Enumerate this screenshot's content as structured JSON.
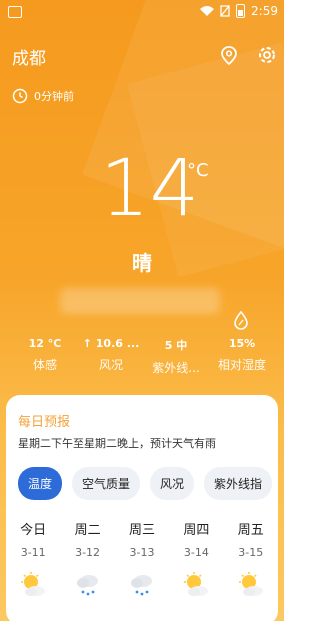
{
  "status": {
    "time": "2:59"
  },
  "header": {
    "city": "成都",
    "updated": "0分钟前"
  },
  "current": {
    "temperature": "14",
    "unit": "°C",
    "condition": "晴"
  },
  "metrics": [
    {
      "value": "12 °C",
      "label": "体感"
    },
    {
      "value": "↑ 10.6 ...",
      "label": "风况"
    },
    {
      "value": "5 中",
      "label": "紫外线..."
    },
    {
      "value": "15%",
      "label": "相对湿度"
    }
  ],
  "forecast": {
    "title": "每日预报",
    "description": "星期二下午至星期二晚上，预计天气有雨",
    "tabs": [
      "温度",
      "空气质量",
      "风况",
      "紫外线指"
    ],
    "days": [
      {
        "name": "今日",
        "date": "3-11",
        "icon": "sun-cloud-icon"
      },
      {
        "name": "周二",
        "date": "3-12",
        "icon": "rain-icon"
      },
      {
        "name": "周三",
        "date": "3-13",
        "icon": "rain-icon"
      },
      {
        "name": "周四",
        "date": "3-14",
        "icon": "sun-cloud-icon"
      },
      {
        "name": "周五",
        "date": "3-15",
        "icon": "sun-cloud-icon"
      }
    ]
  },
  "colors": {
    "accent": "#2d6bd8",
    "title": "#f2a33a",
    "background": "#f7a52a"
  }
}
